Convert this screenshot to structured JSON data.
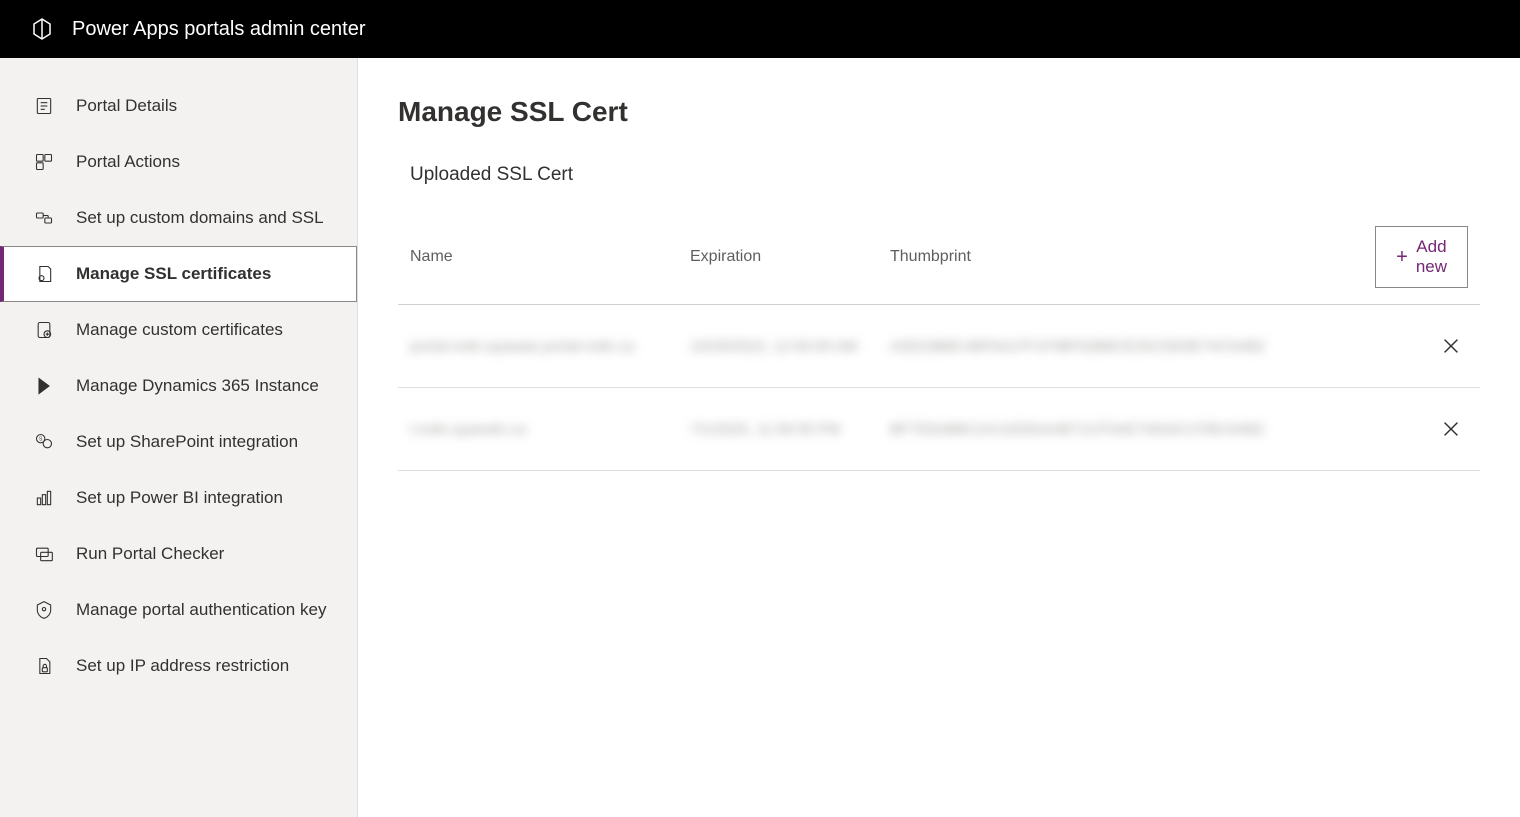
{
  "topbar": {
    "title": "Power Apps portals admin center"
  },
  "sidebar": {
    "items": [
      {
        "label": "Portal Details",
        "selected": false
      },
      {
        "label": "Portal Actions",
        "selected": false
      },
      {
        "label": "Set up custom domains and SSL",
        "selected": false
      },
      {
        "label": "Manage SSL certificates",
        "selected": true
      },
      {
        "label": "Manage custom certificates",
        "selected": false
      },
      {
        "label": "Manage Dynamics 365 Instance",
        "selected": false
      },
      {
        "label": "Set up SharePoint integration",
        "selected": false
      },
      {
        "label": "Set up Power BI integration",
        "selected": false
      },
      {
        "label": "Run Portal Checker",
        "selected": false
      },
      {
        "label": "Manage portal authentication key",
        "selected": false
      },
      {
        "label": "Set up IP address restriction",
        "selected": false
      }
    ]
  },
  "page": {
    "title": "Manage SSL Cert",
    "section_title": "Uploaded SSL Cert"
  },
  "table": {
    "columns": {
      "name": "Name",
      "expiration": "Expiration",
      "thumbprint": "Thumbprint"
    },
    "add_new_label": "Add new",
    "rows": [
      {
        "name": "portal-mdn-ayawae.portal-mdn.ca",
        "expiration": "10/29/2022, 12:00:00 AM",
        "thumbprint": "A3D23B8C48F6A27F1F98F62B8CE25CDE6E74C5AB2"
      },
      {
        "name": "t-mdn.ayamdn.ca",
        "expiration": "7/1/2025, 11:59:59 PM",
        "thumbprint": "BF7D5AB8C2A132DDAAB71CF5AE7463AC37BC0AB2"
      }
    ]
  }
}
